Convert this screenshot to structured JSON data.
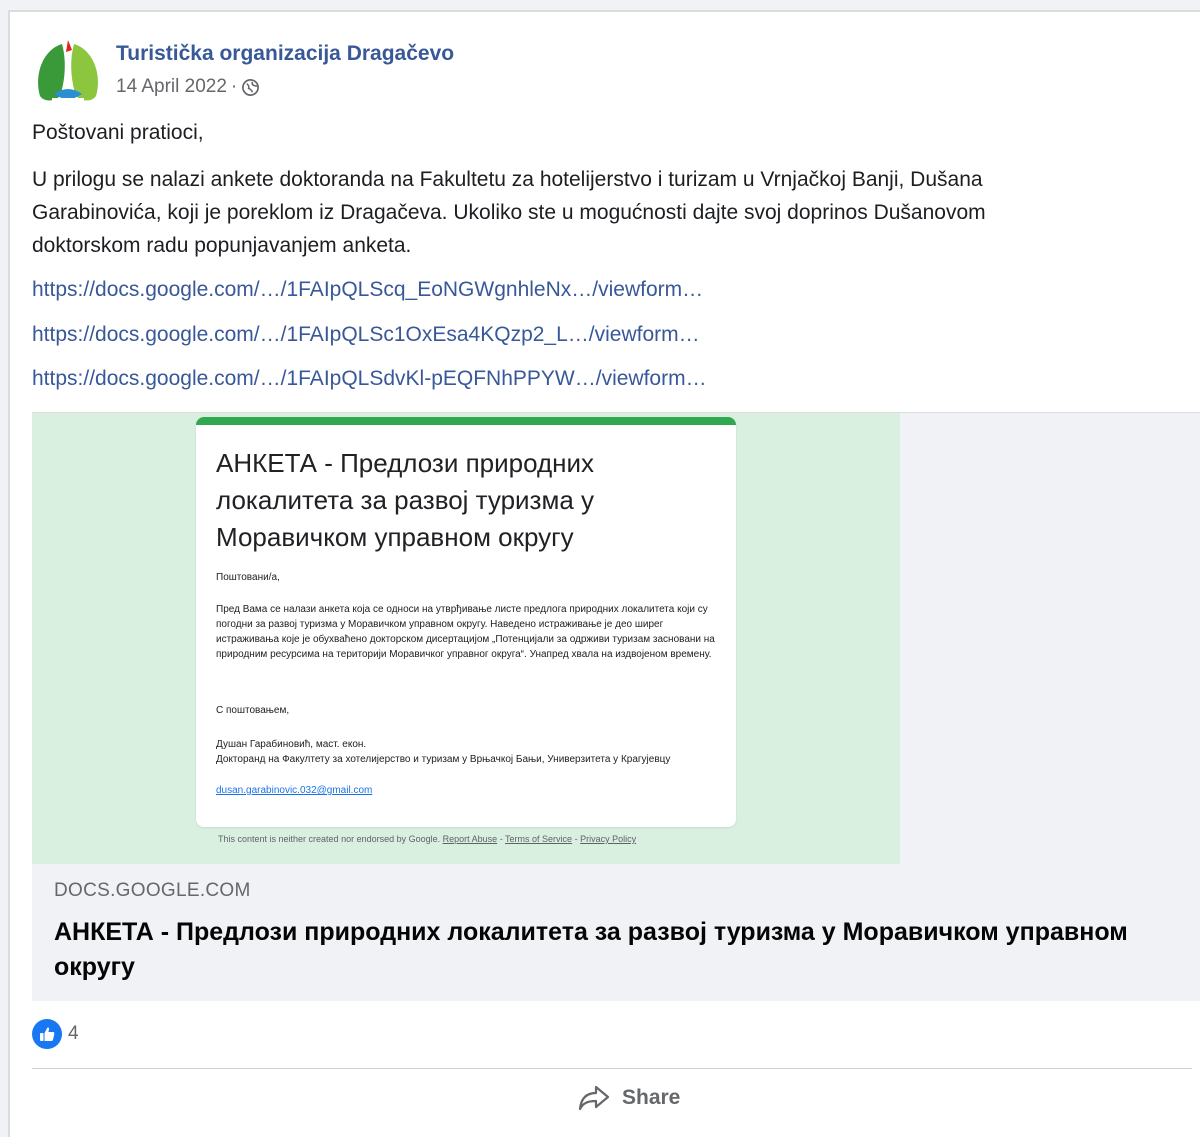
{
  "post": {
    "page_name": "Turistička organizacija Dragačevo",
    "date": "14 April 2022",
    "separator": "·",
    "audience_icon": "globe-icon",
    "greeting": "Poštovani pratioci,",
    "body_lines": [
      "U prilogu se nalazi ankete doktoranda na Fakultetu za hotelijerstvo i turizam u Vrnjačkoj Banji, Dušana",
      "Garabinovića, koji je poreklom iz Dragačeva. Ukoliko ste u mogućnosti dajte svoj doprinos Dušanovom",
      "doktorskom radu popunjavanjem anketa."
    ],
    "links": [
      "https://docs.google.com/…/1FAIpQLScq_EoNGWgnhleNx…/viewform…",
      "https://docs.google.com/…/1FAIpQLSc1OxEsa4KQzp2_L…/viewform…",
      "https://docs.google.com/…/1FAIpQLSdvKl-pEQFNhPPYW…/viewform…"
    ]
  },
  "preview": {
    "form_title": "АНКЕТА - Предлози природних локалитета за развој туризма у Моравичком управном округу",
    "form_greeting": "Поштовани/а,",
    "form_body": "Пред Вама се налази анкета која се односи на утврђивање листе предлога природних локалитета који су погодни за развој туризма у Моравичком управном округу. Наведено истраживање је део ширег истраживања које је обухваћено докторском дисертацијом „Потенцијали за одрживи туризам засновани на природним ресурсима на територији Моравичког управног округа“. Унапред хвала на издвојеном времену.",
    "form_regards": "С поштовањем,",
    "form_signature_name": "Душан Гарабиновић, маст. екон.",
    "form_signature_role": "Докторанд на Факултету за хотелијерство и туризам у Врњачкој Бањи, Универзитета у Крагујевцу",
    "form_email": "dusan.garabinovic.032@gmail.com",
    "footer_text": "This content is neither created nor endorsed by Google.",
    "footer_report": "Report Abuse",
    "footer_sep": " - ",
    "footer_terms": "Terms of Service",
    "footer_privacy": "Privacy Policy",
    "domain": "DOCS.GOOGLE.COM",
    "title": "АНКЕТА - Предлози природних локалитета за развој туризма у Моравичком управном округу"
  },
  "reactions": {
    "icon": "like-icon",
    "count": "4"
  },
  "actions": {
    "share_label": "Share",
    "share_icon": "share-icon"
  },
  "colors": {
    "link": "#385898",
    "like": "#1877f2",
    "form_accent": "#2fa84f",
    "preview_bg": "#d9efdf"
  }
}
